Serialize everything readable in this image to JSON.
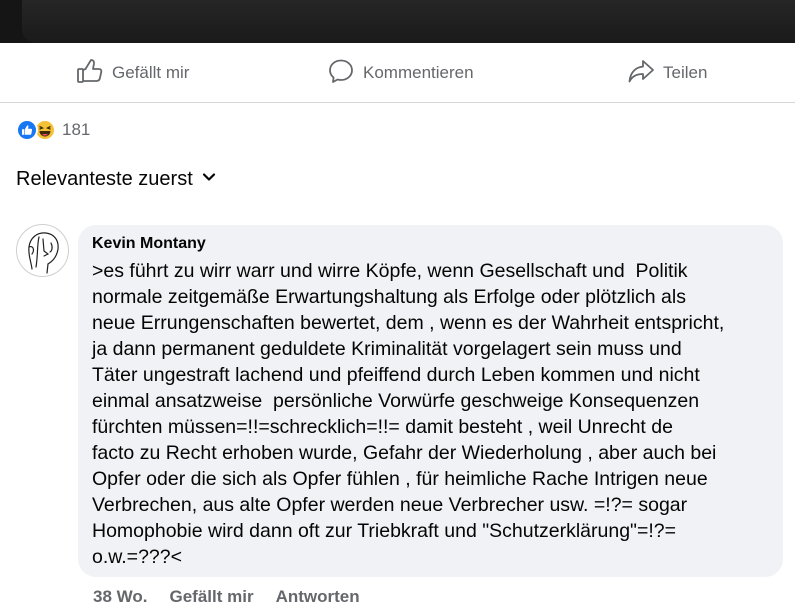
{
  "colors": {
    "action_text": "#65676b",
    "bubble_bg": "#f0f2f5",
    "like_blue": "#1877f2",
    "haha_yellow": "#f7c136"
  },
  "action_bar": {
    "like": {
      "label": "Gefällt mir",
      "icon": "thumbs-up-outline-icon"
    },
    "comment": {
      "label": "Kommentieren",
      "icon": "speech-bubble-icon"
    },
    "share": {
      "label": "Teilen",
      "icon": "share-arrow-icon"
    }
  },
  "reactions": {
    "types": [
      "like",
      "haha"
    ],
    "count": "181"
  },
  "sort": {
    "label": "Relevanteste zuerst",
    "icon": "chevron-down-icon"
  },
  "comment": {
    "author": "Kevin Montany",
    "text": ">es führt zu wirr warr und wirre Köpfe, wenn Gesellschaft und  Politik\nnormale zeitgemäße Erwartungshaltung als Erfolge oder plötzlich als\nneue Errungenschaften bewertet, dem , wenn es der Wahrheit entspricht,\nja dann permanent geduldete Kriminalität vorgelagert sein muss und\nTäter ungestraft lachend und pfeiffend durch Leben kommen und nicht\neinmal ansatzweise  persönliche Vorwürfe geschweige Konsequenzen\nfürchten müssen=!!=schrecklich=!!= damit besteht , weil Unrecht de\nfacto zu Recht erhoben wurde, Gefahr der Wiederholung , aber auch bei\nOpfer oder die sich als Opfer fühlen , für heimliche Rache Intrigen neue\nVerbrechen, aus alte Opfer werden neue Verbrecher usw. =!?= sogar\nHomophobie wird dann oft zur Triebkraft und \"Schutzerklärung\"=!?=\no.w.=???<",
    "time": "38 Wo.",
    "like_label": "Gefällt mir",
    "reply_label": "Antworten"
  }
}
